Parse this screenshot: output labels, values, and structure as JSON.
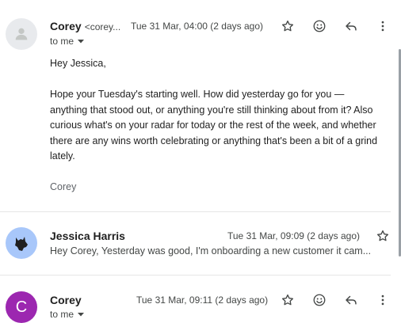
{
  "messages": [
    {
      "sender": "Corey",
      "email": "<corey...",
      "date": "Tue 31 Mar, 04:00 (2 days ago)",
      "to": "to me",
      "body": {
        "greeting": "Hey Jessica,",
        "paragraph_lines": [
          "Hope your Tuesday's starting well. How did yesterday go for you —",
          "anything that stood out, or anything you're still thinking about from it? Also",
          "curious what's on your radar for today or the rest of the week, and whether",
          "there are any wins worth celebrating or anything that's been a bit of a grind",
          "lately."
        ],
        "signature": "Corey"
      }
    },
    {
      "sender": "Jessica Harris",
      "date": "Tue 31 Mar, 09:09 (2 days ago)",
      "snippet": "Hey Corey, Yesterday was good, I'm onboarding a new customer it cam..."
    },
    {
      "sender": "Corey",
      "avatar_letter": "C",
      "date": "Tue 31 Mar, 09:11 (2 days ago)",
      "to": "to me"
    }
  ],
  "colors": {
    "avatar_default_bg": "#e8eaed",
    "avatar_blue_bg": "#a8c7fa",
    "avatar_purple_bg": "#9c27b0"
  },
  "icons": [
    "star-icon",
    "emoji-icon",
    "reply-icon",
    "more-vert-icon",
    "chevron-down-icon",
    "person-icon",
    "wolf-avatar-icon"
  ]
}
